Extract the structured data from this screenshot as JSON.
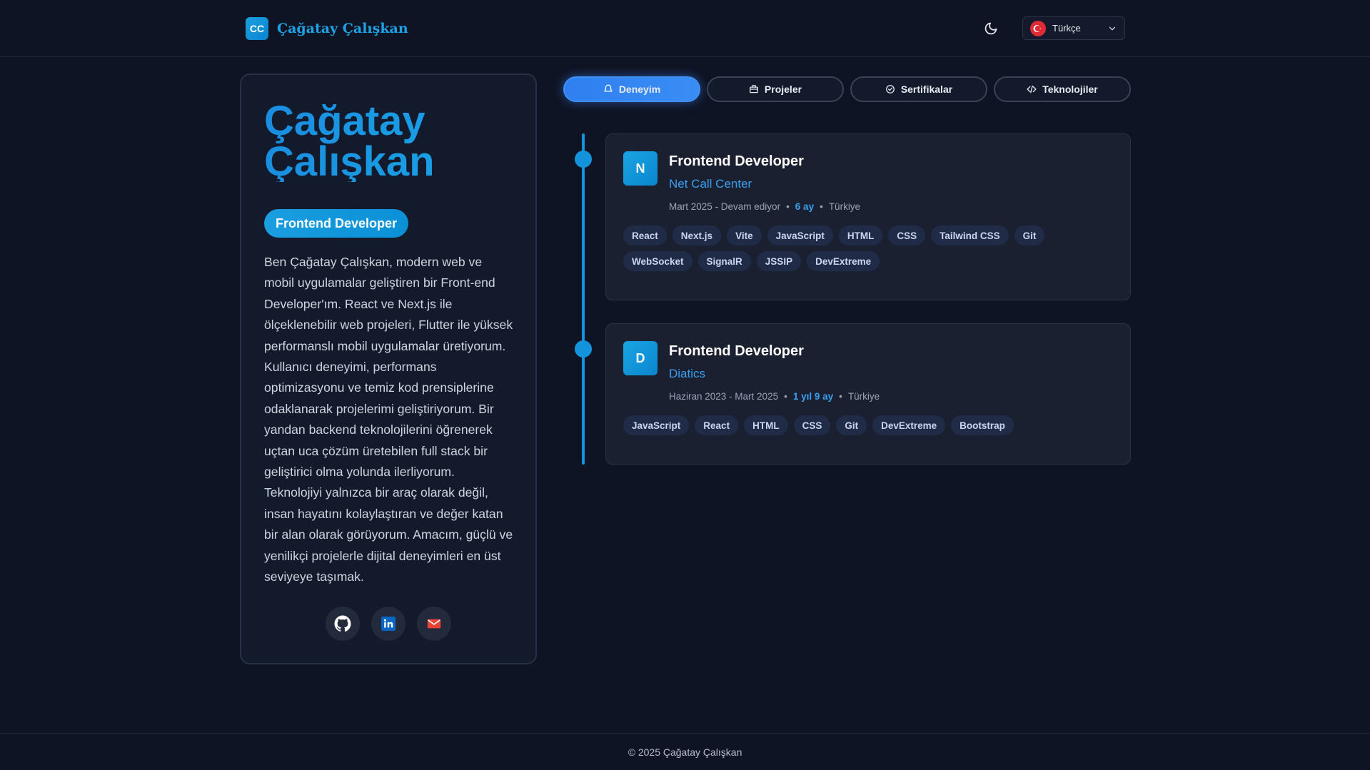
{
  "header": {
    "logo_initials": "CC",
    "brand_name": "Çağatay Çalışkan",
    "language": "Türkçe"
  },
  "profile": {
    "name_line1": "Çağatay",
    "name_line2": "Çalışkan",
    "role": "Frontend Developer",
    "bio": "Ben Çağatay Çalışkan, modern web ve mobil uygulamalar geliştiren bir Front-end Developer'ım. React ve Next.js ile ölçeklenebilir web projeleri, Flutter ile yüksek performanslı mobil uygulamalar üretiyorum. Kullanıcı deneyimi, performans optimizasyonu ve temiz kod prensiplerine odaklanarak projelerimi geliştiriyorum. Bir yandan backend teknolojilerini öğrenerek uçtan uca çözüm üretebilen full stack bir geliştirici olma yolunda ilerliyorum. Teknolojiyi yalnızca bir araç olarak değil, insan hayatını kolaylaştıran ve değer katan bir alan olarak görüyorum. Amacım, güçlü ve yenilikçi projelerle dijital deneyimleri en üst seviyeye taşımak.",
    "socials": [
      "github-icon",
      "linkedin-icon",
      "mail-icon"
    ]
  },
  "tabs": [
    {
      "label": "Deneyim",
      "icon": "bell-icon",
      "active": true
    },
    {
      "label": "Projeler",
      "icon": "briefcase-icon",
      "active": false
    },
    {
      "label": "Sertifikalar",
      "icon": "check-circle-icon",
      "active": false
    },
    {
      "label": "Teknolojiler",
      "icon": "code-icon",
      "active": false
    }
  ],
  "experiences": [
    {
      "initial": "N",
      "title": "Frontend Developer",
      "company": "Net Call Center",
      "period": "Mart 2025 - Devam ediyor",
      "duration": "6 ay",
      "location": "Türkiye",
      "tags": [
        "React",
        "Next.js",
        "Vite",
        "JavaScript",
        "HTML",
        "CSS",
        "Tailwind CSS",
        "Git",
        "WebSocket",
        "SignalR",
        "JSSIP",
        "DevExtreme"
      ]
    },
    {
      "initial": "D",
      "title": "Frontend Developer",
      "company": "Diatics",
      "period": "Haziran 2023 - Mart 2025",
      "duration": "1 yıl 9 ay",
      "location": "Türkiye",
      "tags": [
        "JavaScript",
        "React",
        "HTML",
        "CSS",
        "Git",
        "DevExtreme",
        "Bootstrap"
      ]
    }
  ],
  "footer": {
    "copyright": "© 2025 Çağatay Çalışkan"
  },
  "colors": {
    "accent": "#1493dd",
    "background": "#0f1424",
    "card": "#1a2030",
    "tag_bg": "#1f2b47"
  }
}
